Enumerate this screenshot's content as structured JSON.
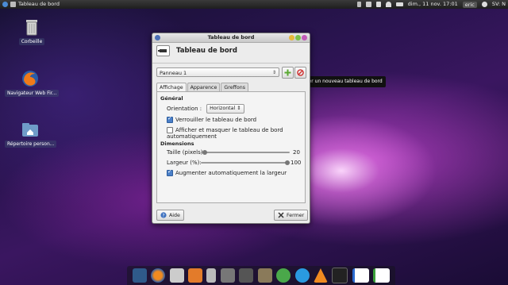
{
  "topbar": {
    "window_title": "Tableau de bord",
    "datetime": "dim., 11 nov. 17:01",
    "user": "eric",
    "keyboard": "SV: N"
  },
  "desktop": {
    "icons": [
      {
        "label": "Corbeille",
        "icon": "trash-icon"
      },
      {
        "label": "Navigateur Web Fir...",
        "icon": "firefox-icon"
      },
      {
        "label": "Répertoire person...",
        "icon": "home-folder-icon"
      }
    ]
  },
  "window": {
    "title": "Tableau de bord",
    "header_title": "Tableau de bord",
    "panel_select": "Panneau 1",
    "tooltip": "Ajouter un nouveau tableau de bord",
    "tabs": [
      "Affichage",
      "Apparence",
      "Greffons"
    ],
    "active_tab": "Affichage",
    "general": {
      "title": "Général",
      "orientation_label": "Orientation :",
      "orientation_value": "Horizontal",
      "lock_label": "Verrouiller le tableau de bord",
      "lock_checked": true,
      "autohide_label": "Afficher et masquer le tableau de bord automatiquement",
      "autohide_checked": false
    },
    "dimensions": {
      "title": "Dimensions",
      "size_label": "Taille (pixels) :",
      "size_value": "20",
      "size_fraction": 0.02,
      "width_label": "Largeur (%):",
      "width_value": "100",
      "width_fraction": 1.0,
      "auto_width_label": "Augmenter automatiquement la largeur",
      "auto_width_checked": true
    },
    "help_label": "Aide",
    "close_label": "Fermer"
  },
  "dock": {
    "items": [
      "desktop-icon",
      "firefox-icon",
      "settings-icon",
      "files-icon",
      "trash-icon",
      "calculator-icon",
      "editor-icon",
      "gimp-icon",
      "messenger-icon",
      "skype-icon",
      "vlc-icon",
      "terminal-icon",
      "writer-icon",
      "calc-icon"
    ]
  },
  "colors": {
    "accent": "#4a7fc8",
    "add": "#5aa832",
    "remove": "#d03030"
  }
}
